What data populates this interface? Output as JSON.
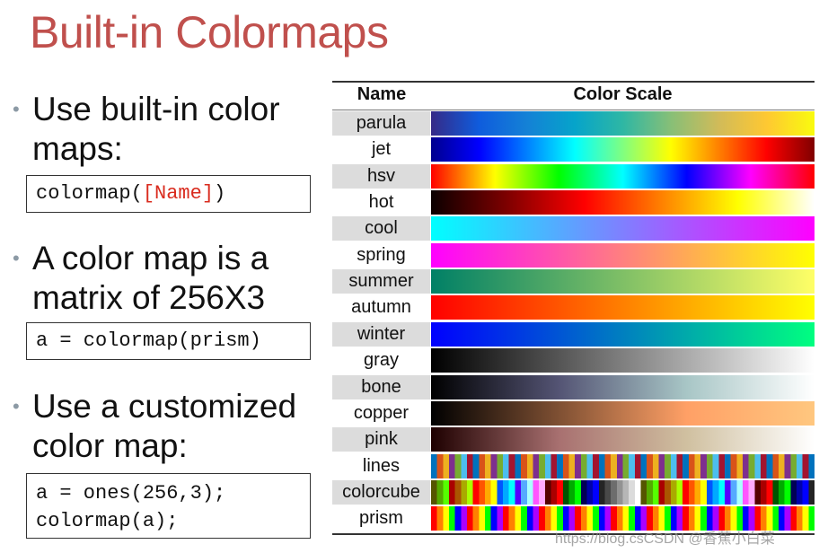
{
  "title": "Built-in Colormaps",
  "bullets": [
    {
      "lines": [
        "Use built-in color",
        "maps:"
      ]
    },
    {
      "lines": [
        "A color map is a",
        "matrix of 256X3"
      ]
    },
    {
      "lines": [
        "Use a customized",
        "color map:"
      ]
    }
  ],
  "code": {
    "block1_prefix": "colormap(",
    "block1_highlight": "[Name]",
    "block1_suffix": ")",
    "block2": "a = colormap(prism)",
    "block3_line1": "a = ones(256,3);",
    "block3_line2": "colormap(a);"
  },
  "table": {
    "header_name": "Name",
    "header_scale": "Color Scale",
    "rows": [
      {
        "name": "parula"
      },
      {
        "name": "jet"
      },
      {
        "name": "hsv"
      },
      {
        "name": "hot"
      },
      {
        "name": "cool"
      },
      {
        "name": "spring"
      },
      {
        "name": "summer"
      },
      {
        "name": "autumn"
      },
      {
        "name": "winter"
      },
      {
        "name": "gray"
      },
      {
        "name": "bone"
      },
      {
        "name": "copper"
      },
      {
        "name": "pink"
      },
      {
        "name": "lines"
      },
      {
        "name": "colorcube"
      },
      {
        "name": "prism"
      }
    ]
  },
  "watermark": "https://blog.csCSDN @香蕉小白菜"
}
